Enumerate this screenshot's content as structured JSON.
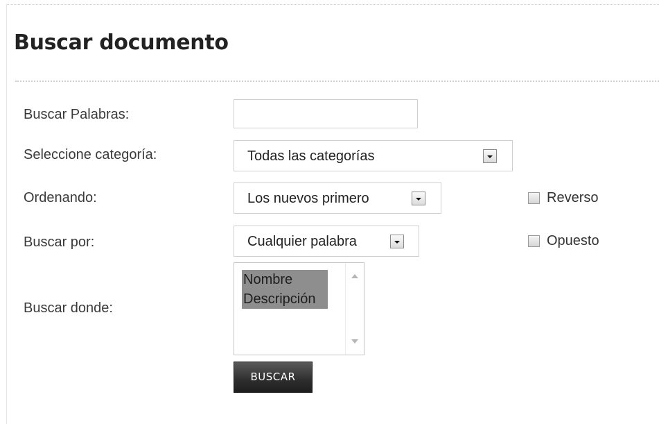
{
  "page_title": "Buscar documento",
  "form": {
    "keywords": {
      "label": "Buscar Palabras:",
      "value": "",
      "placeholder": ""
    },
    "category": {
      "label": "Seleccione categoría:",
      "selected": "Todas las categorías"
    },
    "ordering": {
      "label": "Ordenando:",
      "selected": "Los nuevos primero",
      "reverse_label": "Reverso",
      "reverse_checked": false
    },
    "search_by": {
      "label": "Buscar por:",
      "selected": "Cualquier palabra",
      "opposite_label": "Opuesto",
      "opposite_checked": false
    },
    "search_where": {
      "label": "Buscar donde:",
      "options": [
        "Nombre",
        "Descripción"
      ],
      "selected": [
        "Nombre",
        "Descripción"
      ]
    },
    "submit_label": "BUSCAR"
  },
  "colors": {
    "selected_option_bg": "#8e8e8e",
    "button_bg": "#2e2e2e",
    "title_text": "#222222"
  },
  "icons": {
    "select_arrow": "chevron-down-icon",
    "scroll_up": "arrow-up-icon",
    "scroll_down": "arrow-down-icon"
  }
}
